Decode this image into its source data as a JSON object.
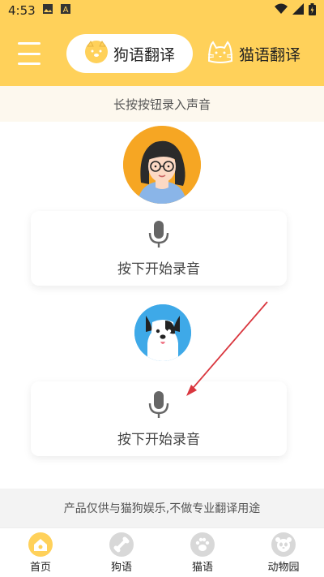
{
  "status_bar": {
    "time": "4:53",
    "icons": [
      "image-icon",
      "a-icon",
      "wifi-icon",
      "signal-icon",
      "battery-icon"
    ]
  },
  "header": {
    "menu_icon": "menu-icon",
    "tab_dog_label": "狗语翻译",
    "tab_cat_label": "猫语翻译",
    "brand_color": "#ffd15a"
  },
  "hint": {
    "text": "长按按钮录入声音"
  },
  "main": {
    "record_human_label": "按下开始录音",
    "record_dog_label": "按下开始录音"
  },
  "footer": {
    "disclaimer": "产品仅供与猫狗娱乐,不做专业翻译用途"
  },
  "bottom_nav": {
    "items": [
      {
        "label": "首页",
        "icon": "home-paw-icon"
      },
      {
        "label": "狗语",
        "icon": "bone-icon"
      },
      {
        "label": "猫语",
        "icon": "paw-icon"
      },
      {
        "label": "动物园",
        "icon": "panda-icon"
      }
    ]
  }
}
